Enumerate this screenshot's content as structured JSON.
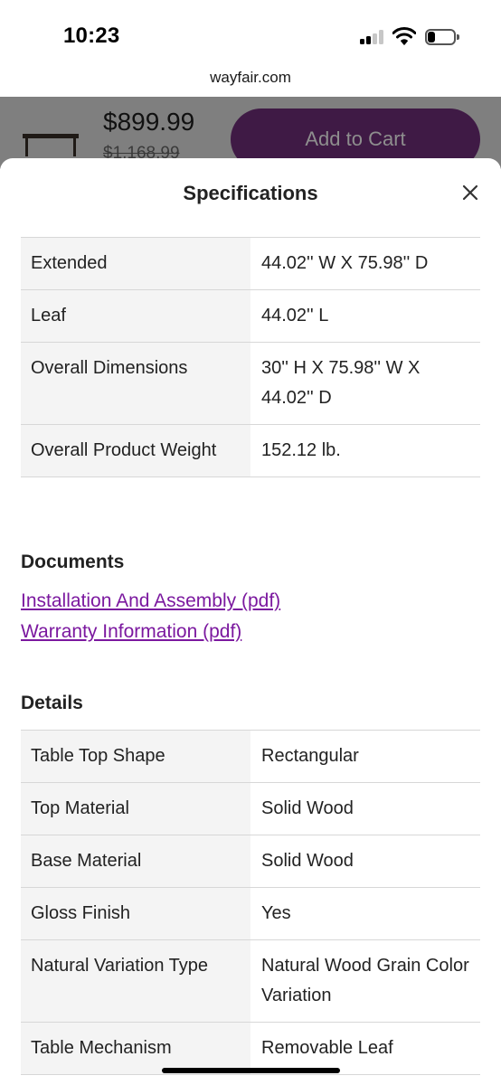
{
  "status_bar": {
    "time": "10:23",
    "icons": [
      "cellular-signal-icon",
      "wifi-icon",
      "battery-icon"
    ]
  },
  "browser": {
    "url": "wayfair.com"
  },
  "product_bar": {
    "price": "$899.99",
    "original_price": "$1,168.99",
    "add_to_cart_label": "Add to Cart",
    "thumbnail_icon": "dining-table-thumbnail"
  },
  "sheet": {
    "title": "Specifications",
    "close_icon": "close-icon"
  },
  "specifications": [
    {
      "label": "Extended",
      "value": "44.02'' W X 75.98'' D"
    },
    {
      "label": "Leaf",
      "value": "44.02'' L"
    },
    {
      "label": "Overall Dimensions",
      "value": "30'' H X 75.98'' W X 44.02'' D"
    },
    {
      "label": "Overall Product Weight",
      "value": "152.12 lb."
    }
  ],
  "documents": {
    "heading": "Documents",
    "links": [
      "Installation And Assembly (pdf)",
      "Warranty Information (pdf)"
    ]
  },
  "details": {
    "heading": "Details",
    "rows": [
      {
        "label": "Table Top Shape",
        "value": "Rectangular"
      },
      {
        "label": "Top Material",
        "value": "Solid Wood"
      },
      {
        "label": "Base Material",
        "value": "Solid Wood"
      },
      {
        "label": "Gloss Finish",
        "value": "Yes"
      },
      {
        "label": "Natural Variation Type",
        "value": "Natural Wood Grain Color Variation"
      },
      {
        "label": "Table Mechanism",
        "value": "Removable Leaf"
      }
    ]
  },
  "colors": {
    "link": "#7b189f",
    "cart_button": "#3f1a45",
    "label_background": "#f4f4f4",
    "divider": "#d7d7d7"
  }
}
